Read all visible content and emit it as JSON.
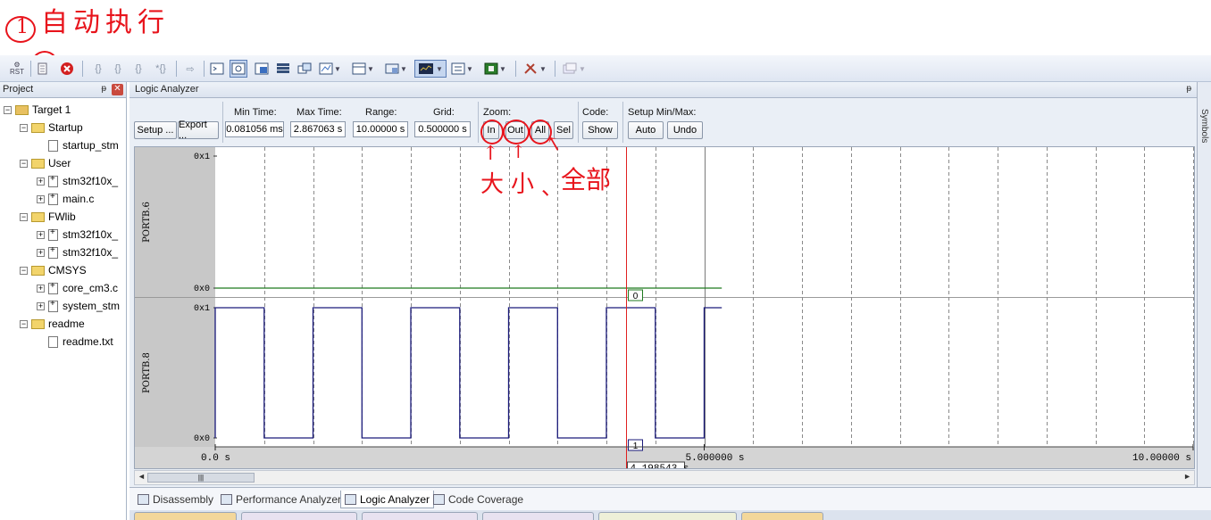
{
  "annotation": {
    "number": "1",
    "top_text": "自动执行",
    "zoom_note_1": "大",
    "zoom_note_2": "小",
    "zoom_note_3": "、",
    "zoom_note_4": "全部",
    "color": "#e8141c"
  },
  "toolbar": {
    "rst_label": "RST",
    "icons": [
      "reset-icon",
      "run-icon",
      "stop-icon",
      "step-into-icon",
      "step-over-icon",
      "step-out-icon",
      "run-to-cursor-icon",
      "show-next-icon",
      "command-window-icon",
      "disassembly-window-icon",
      "symbols-window-icon",
      "registers-window-icon",
      "call-stack-icon",
      "watch-window-icon",
      "memory-window-icon",
      "serial-window-icon",
      "analysis-window-icon",
      "trace-window-icon",
      "system-viewer-icon",
      "toolbox-icon",
      "debug-restore-icon"
    ]
  },
  "project": {
    "title": "Project",
    "items": [
      {
        "label": "Target 1",
        "level": 0,
        "type": "target",
        "expander": "-"
      },
      {
        "label": "Startup",
        "level": 1,
        "type": "folder",
        "expander": "-"
      },
      {
        "label": "startup_stm",
        "level": 2,
        "type": "file",
        "expander": ""
      },
      {
        "label": "User",
        "level": 1,
        "type": "folder",
        "expander": "-"
      },
      {
        "label": "stm32f10x_",
        "level": 2,
        "type": "file",
        "expander": "+"
      },
      {
        "label": "main.c",
        "level": 2,
        "type": "file",
        "expander": "+"
      },
      {
        "label": "FWlib",
        "level": 1,
        "type": "folder",
        "expander": "-"
      },
      {
        "label": "stm32f10x_",
        "level": 2,
        "type": "file",
        "expander": "+"
      },
      {
        "label": "stm32f10x_",
        "level": 2,
        "type": "file",
        "expander": "+"
      },
      {
        "label": "CMSYS",
        "level": 1,
        "type": "folder",
        "expander": "-"
      },
      {
        "label": "core_cm3.c",
        "level": 2,
        "type": "file",
        "expander": "+"
      },
      {
        "label": "system_stm",
        "level": 2,
        "type": "file",
        "expander": "+"
      },
      {
        "label": "readme",
        "level": 1,
        "type": "folder",
        "expander": "-"
      },
      {
        "label": "readme.txt",
        "level": 2,
        "type": "file",
        "expander": ""
      }
    ]
  },
  "la": {
    "title": "Logic Analyzer",
    "setup": "Setup ...",
    "export": "Export ...",
    "min_time_label": "Min Time:",
    "min_time": "0.081056 ms",
    "max_time_label": "Max Time:",
    "max_time": "2.867063 s",
    "range_label": "Range:",
    "range": "10.00000 s",
    "grid_label": "Grid:",
    "grid": "0.500000 s",
    "zoom_label": "Zoom:",
    "zoom_in": "In",
    "zoom_out": "Out",
    "zoom_all": "All",
    "zoom_sel": "Sel",
    "code_label": "Code:",
    "code_show": "Show",
    "setup_minmax_label": "Setup Min/Max:",
    "auto": "Auto",
    "undo": "Undo",
    "side_tab": "Symbols"
  },
  "chart_data": {
    "type": "line",
    "x_unit": "s",
    "xlim": [
      0,
      10
    ],
    "grid_step": 0.5,
    "x_tick_labels": [
      "0.0  s",
      "5.000000  s",
      "10.00000 s"
    ],
    "cursor_time": 4.198543,
    "cursor_label": "4.198543  s",
    "series": [
      {
        "name": "PORTB.6",
        "y_labels": [
          "0x1",
          "0x0"
        ],
        "color": "#1f7a1f",
        "points": [
          [
            0,
            0
          ],
          [
            5.18,
            0
          ]
        ],
        "cursor_value": "0"
      },
      {
        "name": "PORTB.8",
        "y_labels": [
          "0x1",
          "0x0"
        ],
        "color": "#1a1a7a",
        "points": [
          [
            0,
            0
          ],
          [
            0,
            1
          ],
          [
            0.5,
            1
          ],
          [
            0.5,
            0
          ],
          [
            1.0,
            0
          ],
          [
            1.0,
            1
          ],
          [
            1.5,
            1
          ],
          [
            1.5,
            0
          ],
          [
            2.0,
            0
          ],
          [
            2.0,
            1
          ],
          [
            2.5,
            1
          ],
          [
            2.5,
            0
          ],
          [
            3.0,
            0
          ],
          [
            3.0,
            1
          ],
          [
            3.5,
            1
          ],
          [
            3.5,
            0
          ],
          [
            4.0,
            0
          ],
          [
            4.0,
            1
          ],
          [
            4.5,
            1
          ],
          [
            4.5,
            0
          ],
          [
            5.0,
            0
          ],
          [
            5.0,
            1
          ],
          [
            5.18,
            1
          ]
        ],
        "cursor_value": "1"
      }
    ]
  },
  "tabs": [
    {
      "label": "Disassembly",
      "active": false
    },
    {
      "label": "Performance Analyzer",
      "active": false
    },
    {
      "label": "Logic Analyzer",
      "active": true
    },
    {
      "label": "Code Coverage",
      "active": false
    }
  ]
}
